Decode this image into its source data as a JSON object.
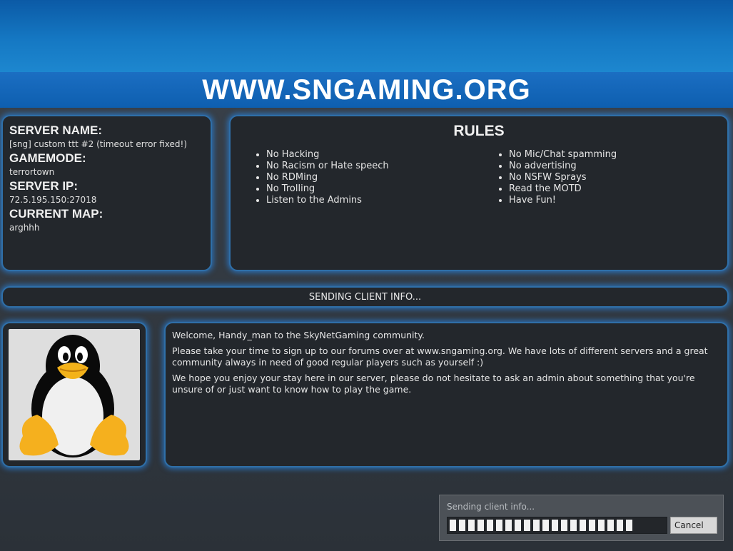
{
  "header": {
    "site_title": "WWW.SNGAMING.ORG"
  },
  "server_info": {
    "name_label": "SERVER NAME:",
    "name_value": "[sng] custom ttt #2 (timeout error fixed!)",
    "gamemode_label": "GAMEMODE:",
    "gamemode_value": "terrortown",
    "ip_label": "SERVER IP:",
    "ip_value": "72.5.195.150:27018",
    "map_label": "CURRENT MAP:",
    "map_value": "arghhh"
  },
  "rules": {
    "title": "RULES",
    "left": [
      "No Hacking",
      "No Racism or Hate speech",
      "No RDMing",
      "No Trolling",
      "Listen to the Admins"
    ],
    "right": [
      "No Mic/Chat spamming",
      "No advertising",
      "No NSFW Sprays",
      "Read the MOTD",
      "Have Fun!"
    ]
  },
  "status_text": "SENDING CLIENT INFO...",
  "welcome": {
    "lines": [
      "Welcome, Handy_man to the SkyNetGaming community.",
      "Please take your time to sign up to our forums over at www.sngaming.org. We have lots of different servers and a great community always in need of good regular players such as yourself :)",
      "We hope you enjoy your stay here in our server, please do not hesitate to ask an admin about something that you're unsure of or just want to know how to play the game."
    ]
  },
  "avatar": {
    "icon": "tux-penguin-icon"
  },
  "progress_dialog": {
    "label": "Sending client info...",
    "progress": 0.85,
    "cancel_label": "Cancel"
  },
  "colors": {
    "accent_blue": "#1578c3",
    "panel_bg": "#23272c",
    "glow": "#2882dc"
  }
}
